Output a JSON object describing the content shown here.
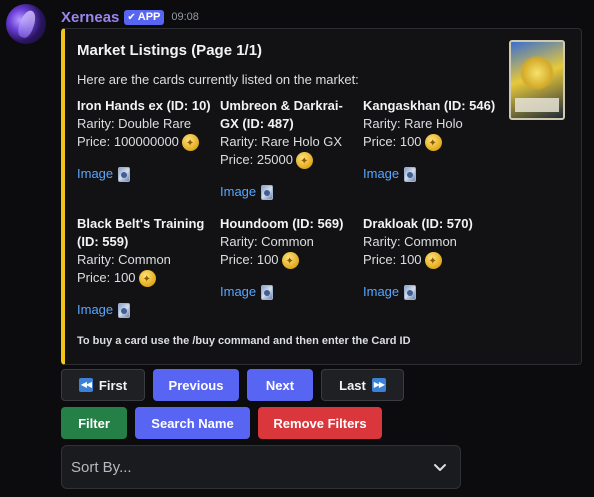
{
  "message": {
    "author": "Xerneas",
    "badge": "APP",
    "timestamp": "09:08"
  },
  "embed": {
    "accent_color": "#f0c419",
    "title": "Market Listings (Page 1/1)",
    "description": "Here are the cards currently listed on the market:",
    "fields": [
      {
        "name": "Iron Hands ex (ID: 10)",
        "rarity": "Rarity: Double Rare",
        "price": "Price: 100000000",
        "link": "Image"
      },
      {
        "name": "Umbreon & Darkrai-GX (ID: 487)",
        "rarity": "Rarity: Rare Holo GX",
        "price": "Price: 25000",
        "link": "Image"
      },
      {
        "name": "Kangaskhan (ID: 546)",
        "rarity": "Rarity: Rare Holo",
        "price": "Price: 100",
        "link": "Image"
      },
      {
        "name": "Black Belt's Training (ID: 559)",
        "rarity": "Rarity: Common",
        "price": "Price: 100",
        "link": "Image"
      },
      {
        "name": "Houndoom (ID: 569)",
        "rarity": "Rarity: Common",
        "price": "Price: 100",
        "link": "Image"
      },
      {
        "name": "Drakloak (ID: 570)",
        "rarity": "Rarity: Common",
        "price": "Price: 100",
        "link": "Image"
      }
    ],
    "footer": "To buy a card use the /buy command and then enter the Card ID"
  },
  "buttons": {
    "first": "First",
    "previous": "Previous",
    "next": "Next",
    "last": "Last",
    "filter": "Filter",
    "search_name": "Search Name",
    "remove_filters": "Remove Filters"
  },
  "select": {
    "placeholder": "Sort By..."
  },
  "colors": {
    "primary": "#5865f2",
    "success": "#248046",
    "danger": "#da373c",
    "username": "#9b84ee",
    "link": "#58a6ff"
  }
}
